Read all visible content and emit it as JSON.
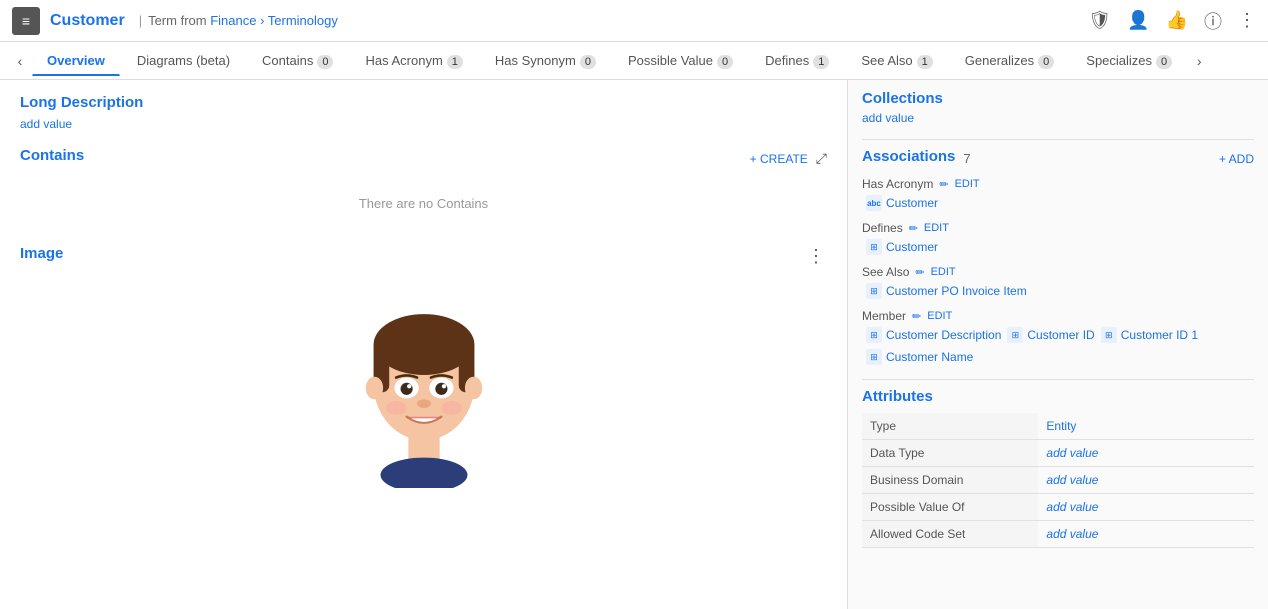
{
  "topbar": {
    "icon": "≡",
    "title": "Customer",
    "separator": "|",
    "term_label": "Term",
    "from_label": "from",
    "breadcrumb": "Finance › Terminology",
    "icons": [
      "shield",
      "person",
      "thumbs-up",
      "info",
      "more-vert"
    ]
  },
  "tabs": [
    {
      "label": "Overview",
      "badge": null,
      "active": true
    },
    {
      "label": "Diagrams (beta)",
      "badge": null,
      "active": false
    },
    {
      "label": "Contains",
      "badge": "0",
      "active": false
    },
    {
      "label": "Has Acronym",
      "badge": "1",
      "active": false
    },
    {
      "label": "Has Synonym",
      "badge": "0",
      "active": false
    },
    {
      "label": "Possible Value",
      "badge": "0",
      "active": false
    },
    {
      "label": "Defines",
      "badge": "1",
      "active": false
    },
    {
      "label": "See Also",
      "badge": "1",
      "active": false
    },
    {
      "label": "Generalizes",
      "badge": "0",
      "active": false
    },
    {
      "label": "Specializes",
      "badge": "0",
      "active": false
    }
  ],
  "left": {
    "long_description_label": "Long Description",
    "add_value_label": "add value",
    "contains_label": "Contains",
    "create_label": "+ CREATE",
    "no_contains_text": "There are no Contains",
    "image_label": "Image",
    "image_menu": "⋮"
  },
  "right": {
    "collections_label": "Collections",
    "collections_add": "add value",
    "associations_label": "Associations",
    "associations_count": "7",
    "add_label": "+ ADD",
    "groups": [
      {
        "label": "Has Acronym",
        "edit_label": "✏ EDIT",
        "items": [
          {
            "icon_type": "abc",
            "icon_text": "abc",
            "name": "Customer"
          }
        ]
      },
      {
        "label": "Defines",
        "edit_label": "✏ EDIT",
        "items": [
          {
            "icon_type": "grid",
            "icon_text": "⊞",
            "name": "Customer"
          }
        ]
      },
      {
        "label": "See Also",
        "edit_label": "✏ EDIT",
        "items": [
          {
            "icon_type": "grid",
            "icon_text": "⊞",
            "name": "Customer PO Invoice Item"
          }
        ]
      },
      {
        "label": "Member",
        "edit_label": "✏ EDIT",
        "items": [
          {
            "icon_type": "grid",
            "icon_text": "⊞",
            "name": "Customer Description"
          },
          {
            "icon_type": "grid",
            "icon_text": "⊞",
            "name": "Customer ID"
          },
          {
            "icon_type": "grid",
            "icon_text": "⊞",
            "name": "Customer ID 1"
          },
          {
            "icon_type": "grid",
            "icon_text": "⊞",
            "name": "Customer Name"
          }
        ]
      }
    ],
    "attributes_label": "Attributes",
    "attributes": [
      {
        "key": "Type",
        "value": "Entity",
        "is_link": false
      },
      {
        "key": "Data Type",
        "value": "add value",
        "is_placeholder": true
      },
      {
        "key": "Business Domain",
        "value": "add value",
        "is_placeholder": true
      },
      {
        "key": "Possible Value Of",
        "value": "add value",
        "is_placeholder": true
      },
      {
        "key": "Allowed Code Set",
        "value": "add value",
        "is_placeholder": true
      }
    ]
  }
}
